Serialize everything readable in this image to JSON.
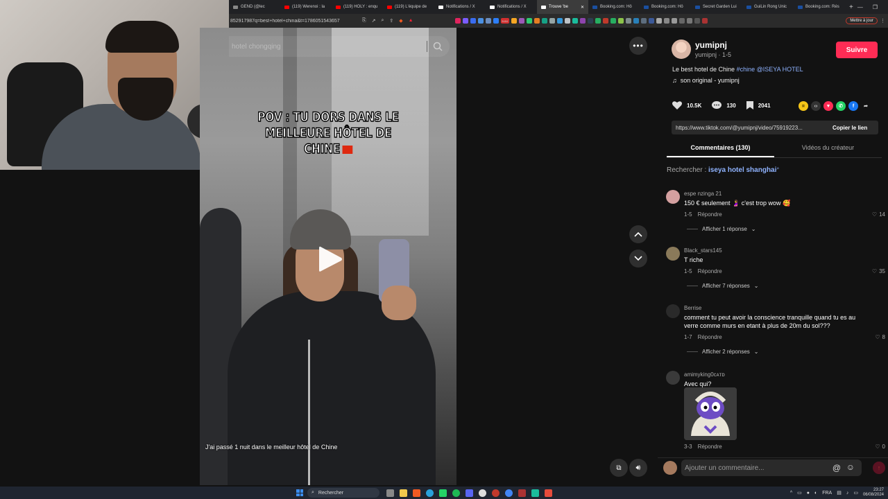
{
  "browser": {
    "tabs": [
      {
        "label": "GEND (@lec",
        "color": "#888888"
      },
      {
        "label": "(119) Werenoi : la",
        "color": "#ff0000"
      },
      {
        "label": "(119) HOLY : enqu",
        "color": "#ff0000"
      },
      {
        "label": "(119) L'équipe de",
        "color": "#ff0000"
      },
      {
        "label": "Notifications / X",
        "color": "#ffffff"
      },
      {
        "label": "Notifications / X",
        "color": "#ffffff"
      },
      {
        "label": "Trouve 'be",
        "color": "#ffffff",
        "active": true
      },
      {
        "label": "Booking.com: Hô",
        "color": "#1a4fa0"
      },
      {
        "label": "Booking.com: Hô",
        "color": "#1a4fa0"
      },
      {
        "label": "Secret Garden Lui",
        "color": "#1a4fa0"
      },
      {
        "label": "GuiLin Rong Unic",
        "color": "#1a4fa0"
      },
      {
        "label": "Booking.com: Rés",
        "color": "#1a4fa0"
      }
    ],
    "new_tab": "+",
    "url": "852917987q=best+hotel+china&t=1786051543657",
    "update_button": "Mettre à jour",
    "badge": "3484"
  },
  "video": {
    "search_placeholder": "hotel chongqing",
    "caption": "POV : TU DORS DANS LE MEILLEURE HÔTEL DE CHINE",
    "subtitle": "J'ai passé 1 nuit dans le meilleur hôtel de Chine"
  },
  "panel": {
    "author": {
      "username": "yumipnj",
      "subline": "yumipnj · 1-5"
    },
    "follow_label": "Suivre",
    "description": {
      "text": "Le best hotel de Chine ",
      "hashtag": "#chine",
      "mention": "@ISEYA HOTEL"
    },
    "music": "son original - yumipnj",
    "stats": {
      "likes": "10.5K",
      "comments": "130",
      "saves": "2041"
    },
    "link": {
      "url": "https://www.tiktok.com/@yumipnj/video/75919223...",
      "copy_label": "Copier le lien"
    },
    "tabs": {
      "comments": "Commentaires (130)",
      "creator": "Vidéos du créateur"
    },
    "search_suggestion": {
      "prefix": "Rechercher : ",
      "query": "iseya hotel shanghai"
    },
    "comments": [
      {
        "user": "espe nzinga 21",
        "text": "150 € seulement 🤰 c'est trop wow 🥰",
        "date": "1-5",
        "reply": "Répondre",
        "likes": "14",
        "more": "Afficher 1 réponse",
        "avatar": "#d4a0a0"
      },
      {
        "user": "Black_stars145",
        "text": "T riche",
        "date": "1-5",
        "reply": "Répondre",
        "likes": "35",
        "more": "Afficher 7 réponses",
        "avatar": "#8a7a5a"
      },
      {
        "user": "Berrise",
        "text": "comment tu peut avoir la conscience tranquille quand tu es au verre comme murs en etant à plus de 20m du sol???",
        "date": "1-7",
        "reply": "Répondre",
        "likes": "8",
        "more": "Afficher 2 réponses",
        "avatar": "#2a2a2a"
      },
      {
        "user": "amimyking0ᴄᴀᴛᴅ",
        "text": "Avec qui?",
        "date": "3-3",
        "reply": "Répondre",
        "likes": "0",
        "avatar": "#3a3a3a"
      }
    ],
    "composer_placeholder": "Ajouter un commentaire...",
    "composer_at": "@",
    "composer_emoji": "☺",
    "send_icon": "↑"
  },
  "taskbar": {
    "search_label": "Rechercher",
    "lang": "FRA",
    "time": "23:27",
    "date": "06/08/2024"
  }
}
